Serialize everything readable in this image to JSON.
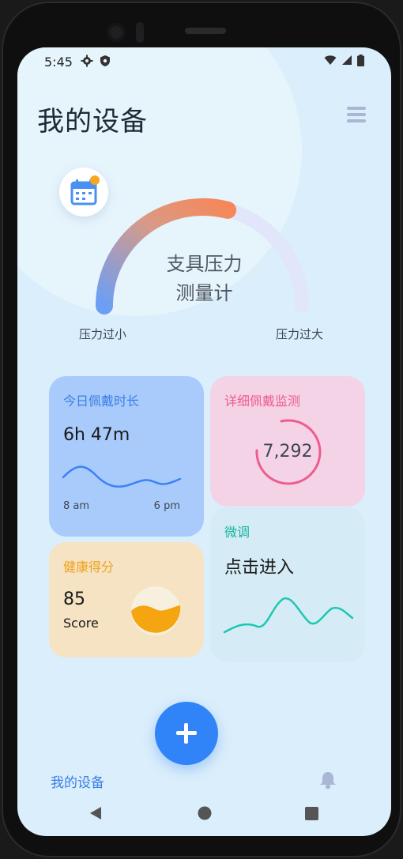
{
  "status_bar": {
    "time": "5:45"
  },
  "header": {
    "title": "我的设备"
  },
  "gauge": {
    "title_line1": "支具压力",
    "title_line2": "测量计",
    "min_label": "压力过小",
    "max_label": "压力过大",
    "level": 0.58
  },
  "cards": {
    "wear_time": {
      "title": "今日佩戴时长",
      "value": "6h 47m",
      "start": "8 am",
      "end": "6 pm"
    },
    "detail": {
      "title": "详细佩戴监测",
      "value": "7,292"
    },
    "health": {
      "title": "健康得分",
      "value": "85",
      "unit": "Score"
    },
    "fine_tune": {
      "title": "微调",
      "action": "点击进入"
    }
  },
  "bottom_nav": {
    "my_devices": "我的设备"
  },
  "colors": {
    "primary": "#3184f7",
    "pink": "#ee5c91",
    "orange": "#f0a21d",
    "teal": "#1ec7b3",
    "gauge_start": "#6c9ef5",
    "gauge_end": "#f6875a"
  },
  "icons": [
    "settings-icon",
    "shield-icon",
    "wifi-icon",
    "signal-icon",
    "battery-icon",
    "menu-icon",
    "calendar-icon",
    "bell-icon",
    "plus-icon",
    "back-icon",
    "home-icon",
    "recents-icon"
  ]
}
